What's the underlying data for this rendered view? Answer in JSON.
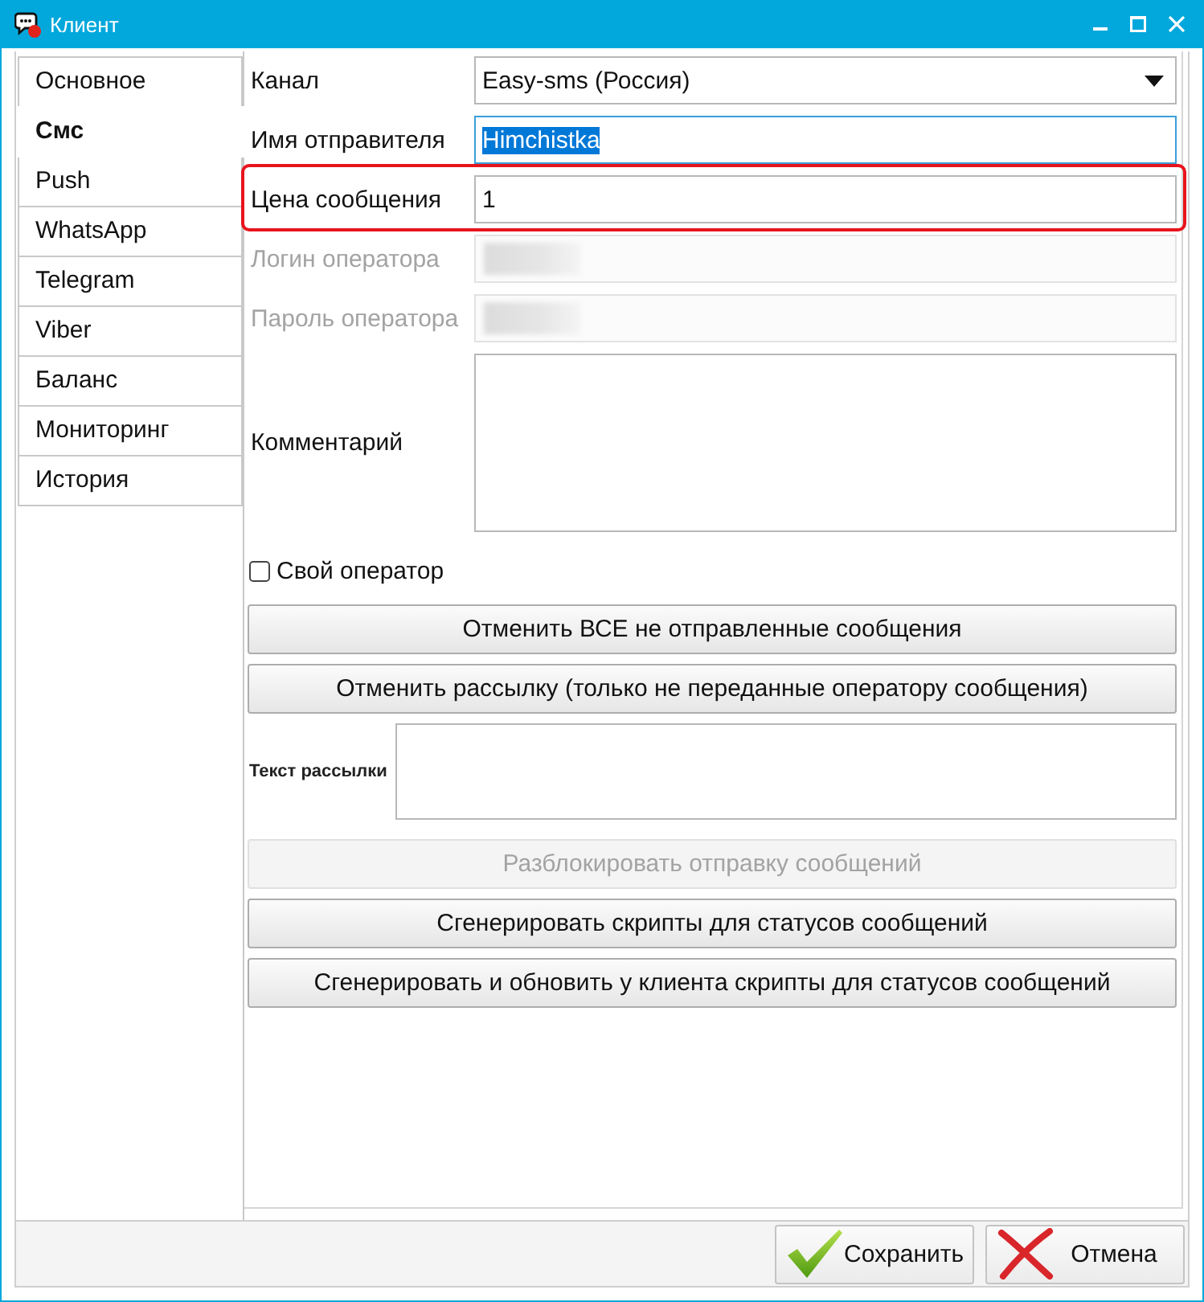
{
  "window": {
    "title": "Клиент"
  },
  "tabs": [
    {
      "label": "Основное",
      "selected": false
    },
    {
      "label": "Смс",
      "selected": true
    },
    {
      "label": "Push",
      "selected": false
    },
    {
      "label": "WhatsApp",
      "selected": false
    },
    {
      "label": "Telegram",
      "selected": false
    },
    {
      "label": "Viber",
      "selected": false
    },
    {
      "label": "Баланс",
      "selected": false
    },
    {
      "label": "Мониторинг",
      "selected": false
    },
    {
      "label": "История",
      "selected": false
    }
  ],
  "fields": [
    {
      "kind": "select",
      "label": "Канал",
      "value": "Easy-sms (Россия)",
      "focused": false,
      "disabled": false,
      "highlighted": false,
      "redacted": false
    },
    {
      "kind": "text",
      "label": "Имя отправителя",
      "value": "Himchistka",
      "focused": true,
      "disabled": false,
      "highlighted": false,
      "redacted": false
    },
    {
      "kind": "text",
      "label": "Цена сообщения",
      "value": "1",
      "focused": false,
      "disabled": false,
      "highlighted": true,
      "redacted": false
    },
    {
      "kind": "text",
      "label": "Логин оператора",
      "focused": false,
      "disabled": true,
      "highlighted": false,
      "redacted": true
    },
    {
      "kind": "text",
      "label": "Пароль оператора",
      "focused": false,
      "disabled": true,
      "highlighted": false,
      "redacted": true
    },
    {
      "kind": "textarea",
      "label": "Комментарий",
      "focused": false,
      "disabled": false,
      "highlighted": false,
      "redacted": false
    }
  ],
  "checkbox": {
    "label": "Свой оператор",
    "checked": false
  },
  "actions": [
    {
      "kind": "button",
      "label": "Отменить ВСЕ не отправленные сообщения",
      "disabled": false
    },
    {
      "kind": "button",
      "label": "Отменить рассылку (только не переданные оператору сообщения)",
      "disabled": false
    },
    {
      "kind": "textarea",
      "label": "Текст рассылки",
      "disabled": false
    },
    {
      "kind": "button",
      "label": "Разблокировать отправку сообщений",
      "disabled": true
    },
    {
      "kind": "button",
      "label": "Сгенерировать скрипты для статусов сообщений",
      "disabled": false
    },
    {
      "kind": "button",
      "label": "Сгенерировать и обновить у клиента скрипты для статусов сообщений",
      "disabled": false
    }
  ],
  "footer_buttons": [
    {
      "kind": "save",
      "label": "Сохранить"
    },
    {
      "kind": "cancel",
      "label": "Отмена"
    }
  ]
}
